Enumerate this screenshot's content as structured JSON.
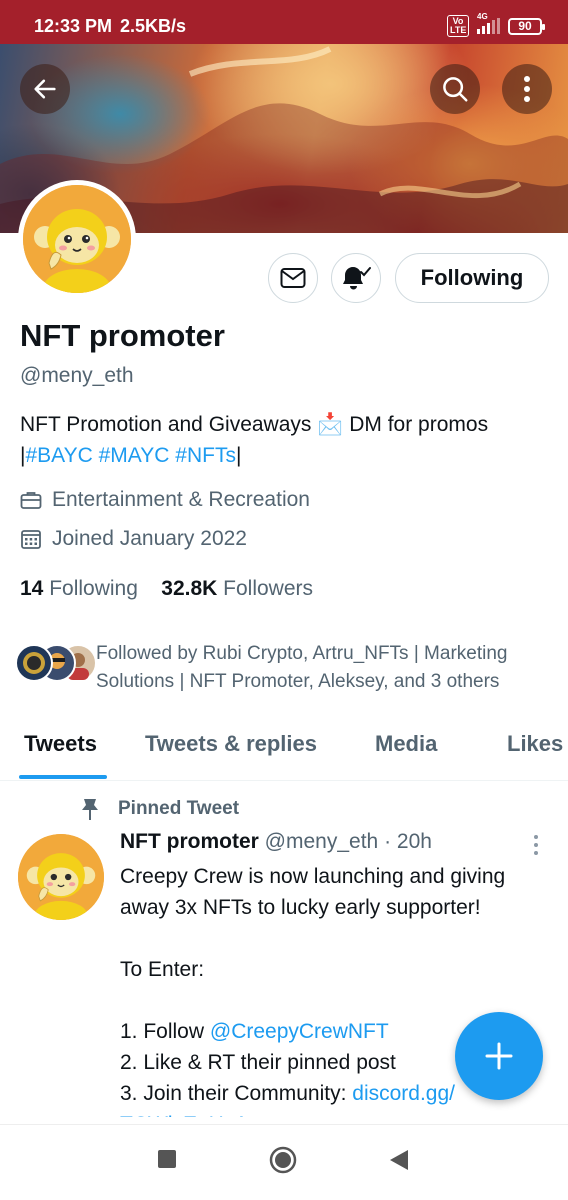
{
  "status_bar": {
    "time": "12:33 PM",
    "speed": "2.5KB/s",
    "network": "4G",
    "volte": "Vo LTE",
    "battery": "90"
  },
  "header": {
    "back_icon": "arrow-left-icon",
    "search_icon": "search-icon",
    "more_icon": "more-vertical-icon"
  },
  "profile": {
    "name": "NFT promoter",
    "handle": "@meny_eth",
    "bio_text": "NFT Promotion and Giveaways 📩 DM for promos",
    "bio_pipe_open": "|",
    "bio_tags": [
      "#BAYC",
      "#MAYC",
      "#NFTs"
    ],
    "bio_pipe_close": "|",
    "category": "Entertainment & Recreation",
    "joined": "Joined January 2022",
    "following_count": "14",
    "following_label": "Following",
    "followers_count": "32.8K",
    "followers_label": "Followers",
    "followed_by": "Followed by Rubi Crypto, Artru_NFTs | Marketing Solutions | NFT Promoter, Aleksey, and 3 others"
  },
  "actions": {
    "message_icon": "envelope-icon",
    "notify_icon": "bell-check-icon",
    "following_button": "Following"
  },
  "tabs": [
    "Tweets",
    "Tweets & replies",
    "Media",
    "Likes"
  ],
  "pinned_tweet": {
    "pinned_label": "Pinned Tweet",
    "author_name": "NFT promoter",
    "author_handle": "@meny_eth",
    "separator": "·",
    "time": "20h",
    "line1": "Creepy Crew is now launching and giving away 3x NFTs to lucky early supporter!",
    "line2": "To Enter:",
    "step1_prefix": "1. Follow ",
    "step1_link": "@CreepyCrewNFT",
    "step2": "2. Like & RT their pinned post",
    "step3_prefix": "3. Join their Community: ",
    "step3_link": "discord.gg/",
    "step3_link_cont": "TCWizEuHzA"
  },
  "colors": {
    "accent": "#1d9bf0",
    "status_bar": "#a4202b",
    "text_secondary": "#536471",
    "avatar_bg": "#f2a93b"
  }
}
